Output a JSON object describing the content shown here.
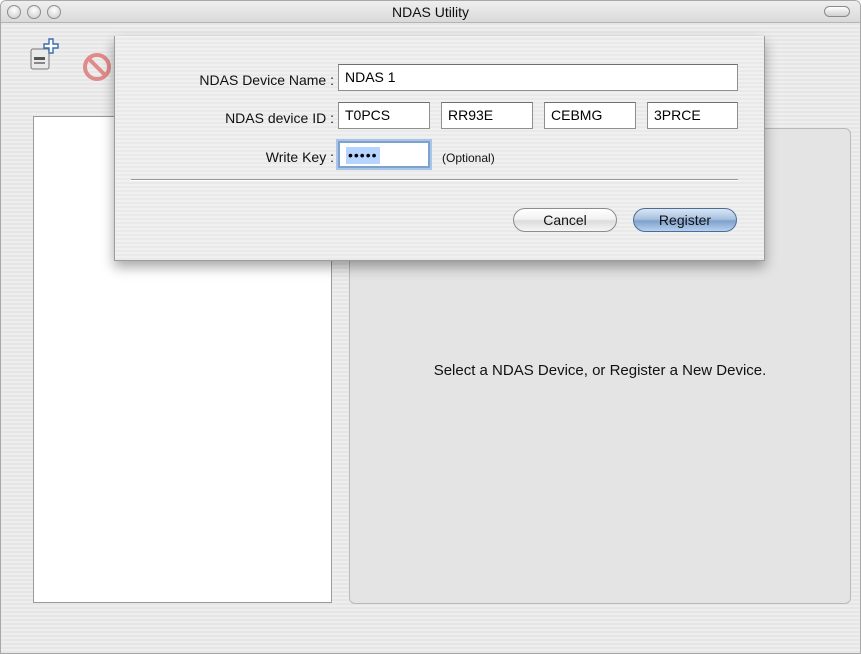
{
  "window": {
    "title": "NDAS Utility"
  },
  "toolbar": {
    "add_icon": "add-device-icon",
    "remove_icon": "unregister-icon"
  },
  "sheet": {
    "device_name_label": "NDAS Device Name :",
    "device_name_value": "NDAS 1",
    "device_id_label": "NDAS device ID :",
    "device_id_parts": [
      "T0PCS",
      "RR93E",
      "CEBMG",
      "3PRCE"
    ],
    "write_key_label": "Write Key :",
    "write_key_value": "•••••",
    "write_key_hint": "(Optional)",
    "cancel_label": "Cancel",
    "register_label": "Register"
  },
  "info_panel": {
    "message": "Select a NDAS Device, or Register a New Device."
  },
  "colors": {
    "selection": "#b5d5ff",
    "focus_ring": "#7da2ce",
    "default_button": "#7fa1cc"
  }
}
